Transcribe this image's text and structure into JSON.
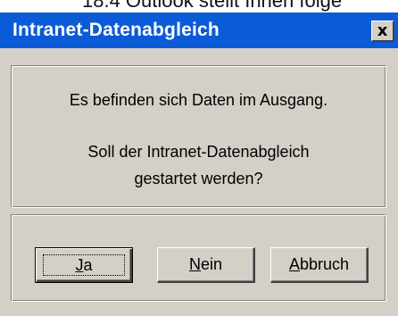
{
  "background_text": "18.4 Outlook stellt Ihnen folge",
  "dialog": {
    "title": "Intranet-Datenabgleich",
    "close_glyph": "x",
    "message_line1": "Es befinden sich Daten im Ausgang.",
    "message_line2": "Soll der Intranet-Datenabgleich",
    "message_line3": "gestartet werden?",
    "buttons": {
      "yes": {
        "accel": "J",
        "rest": "a"
      },
      "no": {
        "accel": "N",
        "rest": "ein"
      },
      "cancel": {
        "accel": "A",
        "rest": "bbruch"
      }
    }
  },
  "colors": {
    "titlebar": "#0b5bd6",
    "dialog_face": "#d4d0c8"
  },
  "icons": {
    "close": "close-icon"
  }
}
